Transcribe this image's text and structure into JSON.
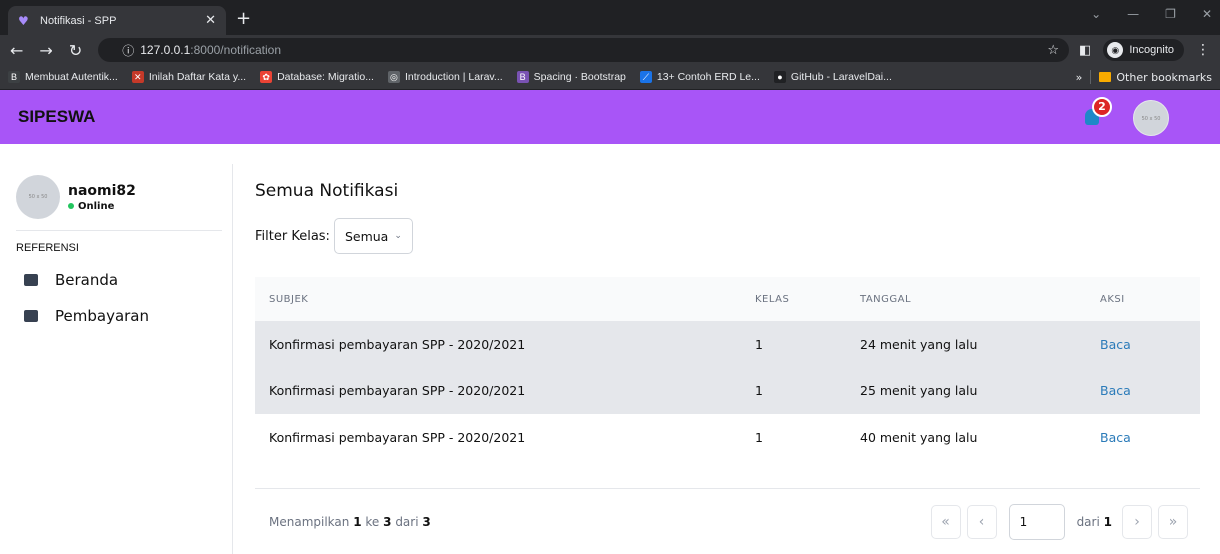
{
  "browser": {
    "tab_title": "Notifikasi - SPP",
    "url_host": "127.0.0.1",
    "url_path": ":8000/notification",
    "incognito_label": "Incognito",
    "bookmarks": [
      {
        "label": "Membuat Autentik...",
        "color": "#3c4043",
        "glyph": "B"
      },
      {
        "label": "Inilah Daftar Kata y...",
        "color": "#c53929",
        "glyph": "✕"
      },
      {
        "label": "Database: Migratio...",
        "color": "#ea4335",
        "glyph": "✿"
      },
      {
        "label": "Introduction | Larav...",
        "color": "#5f6368",
        "glyph": "◎"
      },
      {
        "label": "Spacing · Bootstrap",
        "color": "#7952b3",
        "glyph": "B"
      },
      {
        "label": "13+ Contoh ERD Le...",
        "color": "#1a73e8",
        "glyph": "⟋"
      },
      {
        "label": "GitHub - LaravelDai...",
        "color": "#202124",
        "glyph": "●"
      }
    ],
    "more_bookmarks": "»",
    "other_bookmarks": "Other bookmarks"
  },
  "app": {
    "brand": "SIPESWA",
    "notification_count": "2",
    "header_avatar_text": "50 x 50",
    "accent": "#a855f7"
  },
  "sidebar": {
    "username": "naomi82",
    "status": "Online",
    "avatar_text": "50 x 50",
    "section_label": "REFERENSI",
    "items": [
      {
        "label": "Beranda",
        "icon": "chart-board-icon"
      },
      {
        "label": "Pembayaran",
        "icon": "cards-icon"
      }
    ]
  },
  "main": {
    "title": "Semua Notifikasi",
    "filter_label": "Filter Kelas:",
    "filter_value": "Semua",
    "columns": [
      "SUBJEK",
      "KELAS",
      "TANGGAL",
      "AKSI"
    ],
    "rows": [
      {
        "subject": "Konfirmasi pembayaran SPP - 2020/2021",
        "kelas": "1",
        "tanggal": "24 menit yang lalu",
        "aksi": "Baca",
        "highlight": true
      },
      {
        "subject": "Konfirmasi pembayaran SPP - 2020/2021",
        "kelas": "1",
        "tanggal": "25 menit yang lalu",
        "aksi": "Baca",
        "highlight": true
      },
      {
        "subject": "Konfirmasi pembayaran SPP - 2020/2021",
        "kelas": "1",
        "tanggal": "40 menit yang lalu",
        "aksi": "Baca",
        "highlight": false
      }
    ]
  },
  "pagination": {
    "showing_prefix": "Menampilkan",
    "from": "1",
    "to_word": "ke",
    "to": "3",
    "of_word": "dari",
    "total": "3",
    "current_page": "1",
    "page_of_word": "dari",
    "total_pages": "1"
  }
}
